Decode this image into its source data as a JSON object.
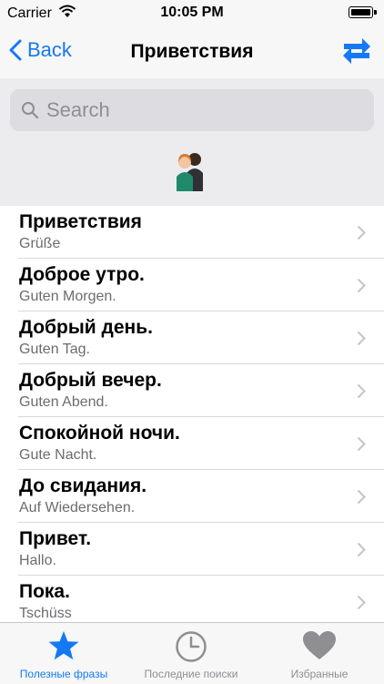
{
  "status_bar": {
    "carrier": "Carrier",
    "time": "10:05 PM"
  },
  "nav": {
    "back_label": "Back",
    "title": "Приветствия"
  },
  "search": {
    "placeholder": "Search"
  },
  "phrases": [
    {
      "ru": "Приветствия",
      "de": "Grüße"
    },
    {
      "ru": "Доброе утро.",
      "de": "Guten Morgen."
    },
    {
      "ru": "Добрый день.",
      "de": "Guten Tag."
    },
    {
      "ru": "Добрый вечер.",
      "de": "Guten Abend."
    },
    {
      "ru": "Спокойной ночи.",
      "de": "Gute Nacht."
    },
    {
      "ru": "До свидания.",
      "de": "Auf Wiedersehen."
    },
    {
      "ru": "Привет.",
      "de": "Hallo."
    },
    {
      "ru": "Пока.",
      "de": "Tschüss"
    }
  ],
  "tabs": [
    {
      "label": "Полезные фразы",
      "icon": "star-icon",
      "active": true
    },
    {
      "label": "Последние поиски",
      "icon": "clock-icon",
      "active": false
    },
    {
      "label": "Избранные",
      "icon": "heart-icon",
      "active": false
    }
  ],
  "colors": {
    "accent": "#1479f5",
    "inactive": "#8e8e93",
    "bar_bg": "#f7f7f7",
    "search_bg": "#ececef"
  }
}
